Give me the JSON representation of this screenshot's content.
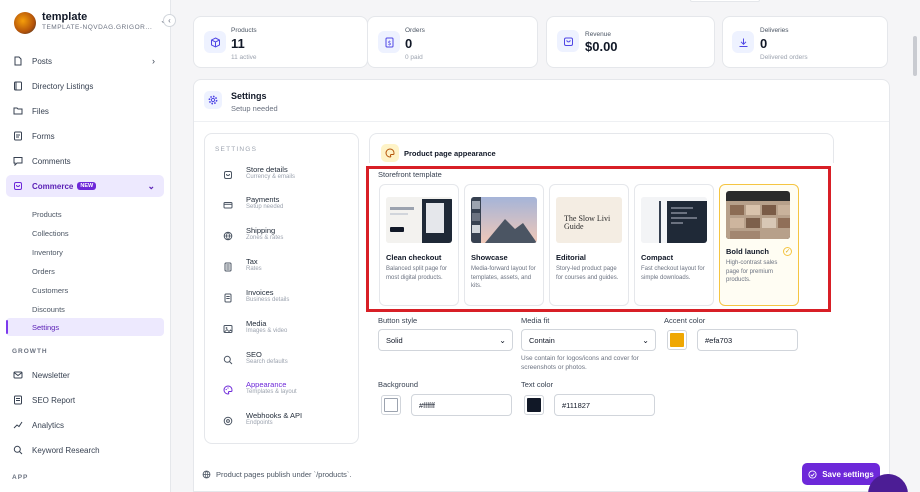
{
  "workspace": {
    "name": "template",
    "subtitle": "TEMPLATE-NQVDAG.GRIGOR..."
  },
  "sidebar": {
    "items": [
      {
        "label": "Posts",
        "icon": "document-icon"
      },
      {
        "label": "Directory Listings",
        "icon": "book-icon"
      },
      {
        "label": "Files",
        "icon": "folder-icon"
      },
      {
        "label": "Forms",
        "icon": "form-icon"
      },
      {
        "label": "Comments",
        "icon": "chat-icon"
      },
      {
        "label": "Commerce",
        "icon": "cart-icon",
        "badge": "NEW"
      }
    ],
    "commerce_sub": [
      "Products",
      "Collections",
      "Inventory",
      "Orders",
      "Customers",
      "Discounts",
      "Settings"
    ],
    "growth_label": "GROWTH",
    "growth_items": [
      {
        "label": "Newsletter",
        "icon": "mail-icon"
      },
      {
        "label": "SEO Report",
        "icon": "report-icon"
      },
      {
        "label": "Analytics",
        "icon": "chart-icon"
      },
      {
        "label": "Keyword Research",
        "icon": "search-icon"
      }
    ],
    "app_label": "APP"
  },
  "stats": [
    {
      "label": "Products",
      "value": "11",
      "sub": "11 active",
      "icon": "box-icon"
    },
    {
      "label": "Orders",
      "value": "0",
      "sub": "0 paid",
      "icon": "receipt-icon"
    },
    {
      "label": "Revenue",
      "value": "$0.00",
      "sub": "",
      "icon": "bag-icon"
    },
    {
      "label": "Deliveries",
      "value": "0",
      "sub": "Delivered orders",
      "icon": "download-icon"
    }
  ],
  "settings": {
    "title": "Settings",
    "subtitle": "Setup needed",
    "nav_label": "SETTINGS",
    "nav": [
      {
        "title": "Store details",
        "desc": "Currency & emails"
      },
      {
        "title": "Payments",
        "desc": "Setup needed"
      },
      {
        "title": "Shipping",
        "desc": "Zones & rates"
      },
      {
        "title": "Tax",
        "desc": "Rates"
      },
      {
        "title": "Invoices",
        "desc": "Business details"
      },
      {
        "title": "Media",
        "desc": "Images & video"
      },
      {
        "title": "SEO",
        "desc": "Search defaults"
      },
      {
        "title": "Appearance",
        "desc": "Templates & layout"
      },
      {
        "title": "Webhooks & API",
        "desc": "Endpoints"
      }
    ]
  },
  "appearance": {
    "card_title": "Product page appearance",
    "template_label": "Storefront template",
    "templates": [
      {
        "name": "Clean checkout",
        "desc": "Balanced split page for most digital products."
      },
      {
        "name": "Showcase",
        "desc": "Media-forward layout for templates, assets, and kits."
      },
      {
        "name": "Editorial",
        "desc": "Story-led product page for courses and guides.",
        "thumb_text": "The Slow Livi Guide"
      },
      {
        "name": "Compact",
        "desc": "Fast checkout layout for simple downloads."
      },
      {
        "name": "Bold launch",
        "desc": "High-contrast sales page for premium products.",
        "selected": true
      }
    ],
    "button_style_label": "Button style",
    "button_style_value": "Solid",
    "media_fit_label": "Media fit",
    "media_fit_value": "Contain",
    "media_fit_help": "Use contain for logos/icons and cover for screenshots or photos.",
    "accent_label": "Accent color",
    "accent_value": "#efa703",
    "background_label": "Background",
    "background_value": "#ffffff",
    "text_color_label": "Text color",
    "text_color_value": "#111827"
  },
  "footer": {
    "note": "Product pages publish under `/products`.",
    "save_label": "Save settings"
  }
}
